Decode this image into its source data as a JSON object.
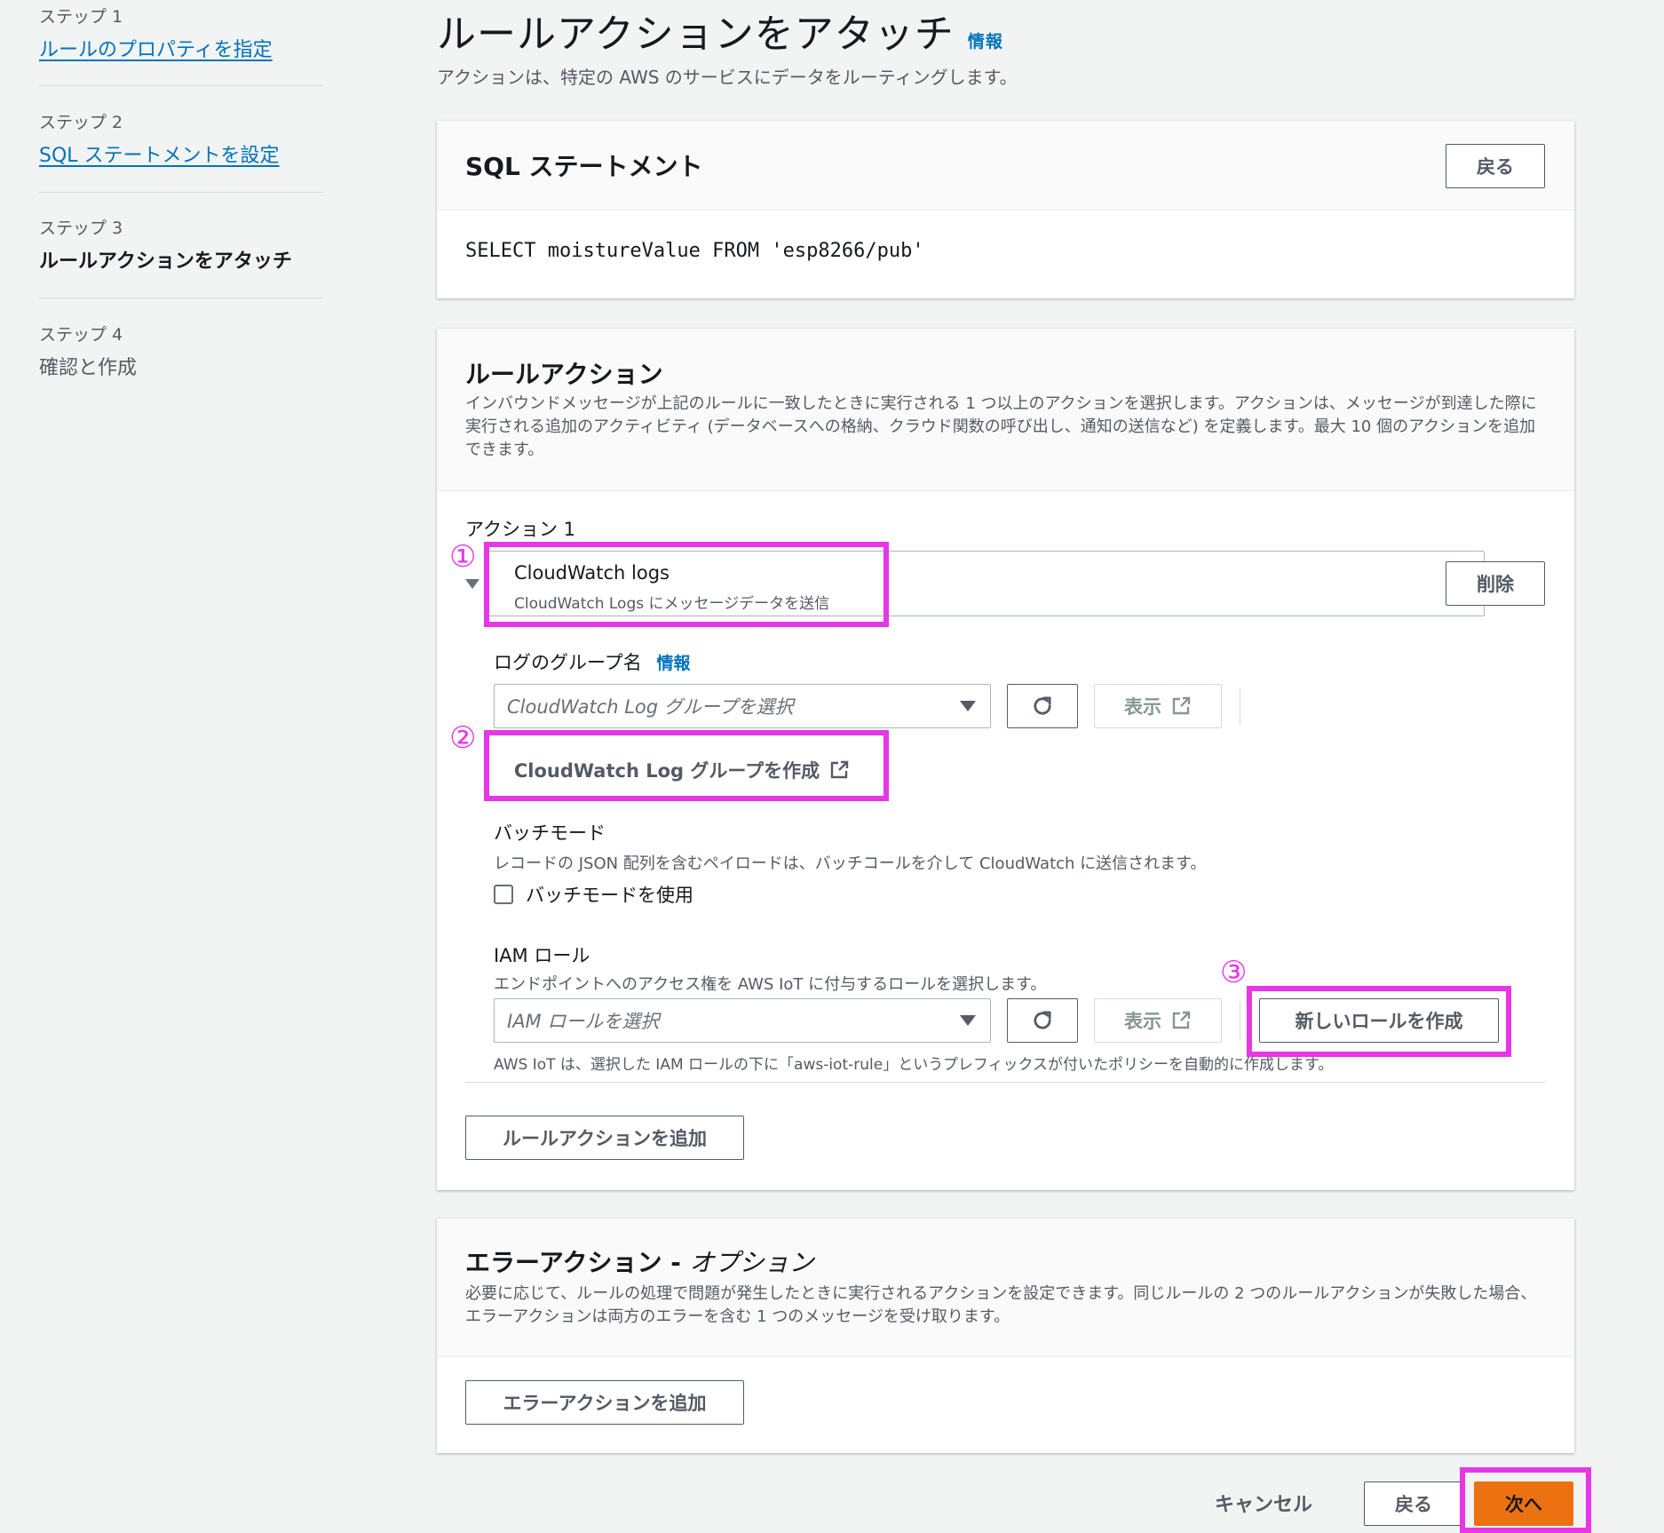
{
  "steps": [
    {
      "label": "ステップ 1",
      "title": "ルールのプロパティを指定"
    },
    {
      "label": "ステップ 2",
      "title": "SQL ステートメントを設定"
    },
    {
      "label": "ステップ 3",
      "title": "ルールアクションをアタッチ"
    },
    {
      "label": "ステップ 4",
      "title": "確認と作成"
    }
  ],
  "header": {
    "title": "ルールアクションをアタッチ",
    "info": "情報",
    "description": "アクションは、特定の AWS のサービスにデータをルーティングします。"
  },
  "sql_panel": {
    "title": "SQL ステートメント",
    "back_button": "戻る",
    "statement": "SELECT moistureValue FROM 'esp8266/pub'"
  },
  "rule_actions": {
    "title": "ルールアクション",
    "description": "インバウンドメッセージが上記のルールに一致したときに実行される 1 つ以上のアクションを選択します。アクションは、メッセージが到達した際に実行される追加のアクティビティ (データベースへの格納、クラウド関数の呼び出し、通知の送信など) を定義します。最大 10 個のアクションを追加できます。",
    "action_label": "アクション 1",
    "action_name": "CloudWatch logs",
    "action_desc": "CloudWatch Logs にメッセージデータを送信",
    "delete_button": "削除",
    "log_group": {
      "label": "ログのグループ名",
      "info": "情報",
      "placeholder": "CloudWatch Log グループを選択",
      "view_button": "表示",
      "create_button": "CloudWatch Log グループを作成"
    },
    "batch": {
      "label": "バッチモード",
      "description": "レコードの JSON 配列を含むペイロードは、バッチコールを介して CloudWatch に送信されます。",
      "checkbox_label": "バッチモードを使用"
    },
    "iam": {
      "label": "IAM ロール",
      "description": "エンドポイントへのアクセス権を AWS IoT に付与するロールを選択します。",
      "placeholder": "IAM ロールを選択",
      "view_button": "表示",
      "create_button": "新しいロールを作成",
      "note": "AWS IoT は、選択した IAM ロールの下に「aws-iot-rule」というプレフィックスが付いたポリシーを自動的に作成します。"
    },
    "add_button": "ルールアクションを追加"
  },
  "error_actions": {
    "title": "エラーアクション - ",
    "title_optional": "オプション",
    "description": "必要に応じて、ルールの処理で問題が発生したときに実行されるアクションを設定できます。同じルールの 2 つのルールアクションが失敗した場合、エラーアクションは両方のエラーを含む 1 つのメッセージを受け取ります。",
    "add_button": "エラーアクションを追加"
  },
  "footer": {
    "cancel": "キャンセル",
    "back": "戻る",
    "next": "次へ"
  },
  "markers": [
    "①",
    "②",
    "③"
  ],
  "colors": {
    "highlight": "#e637e6",
    "primary": "#ec7211",
    "link": "#0073bb"
  }
}
